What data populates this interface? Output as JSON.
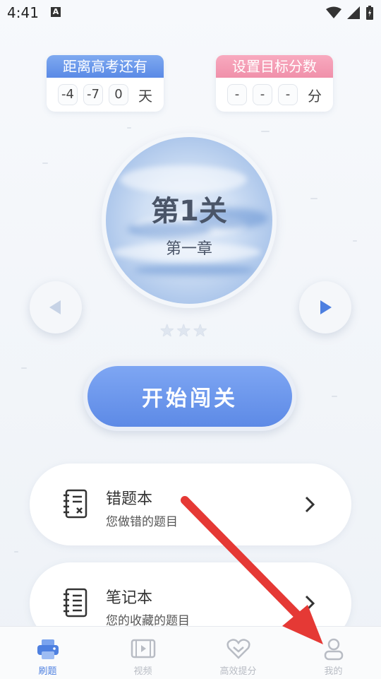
{
  "status_bar": {
    "time": "4:41",
    "notification_badge": "A"
  },
  "countdown": {
    "title": "距离高考还有",
    "values": [
      "-4",
      "-7",
      "0"
    ],
    "unit": "天",
    "color": "#5a8ae6"
  },
  "target_score": {
    "title": "设置目标分数",
    "values": [
      "-",
      "-",
      "-"
    ],
    "unit": "分",
    "color": "#f090aa"
  },
  "level": {
    "title": "第1关",
    "subtitle": "第一章",
    "stars_earned": 0,
    "stars_total": 3
  },
  "start_button": {
    "label": "开始闯关"
  },
  "menu": [
    {
      "title": "错题本",
      "subtitle": "您做错的题目",
      "icon": "wrong-notebook-icon"
    },
    {
      "title": "笔记本",
      "subtitle": "您的收藏的题目",
      "icon": "notebook-icon"
    }
  ],
  "tabs": [
    {
      "label": "刷题",
      "icon": "printer-icon",
      "active": true
    },
    {
      "label": "视频",
      "icon": "video-icon",
      "active": false
    },
    {
      "label": "高效提分",
      "icon": "heart-icon",
      "active": false
    },
    {
      "label": "我的",
      "icon": "user-icon",
      "active": false
    }
  ],
  "colors": {
    "accent": "#4e80e0",
    "annotation_arrow": "#e53935"
  }
}
